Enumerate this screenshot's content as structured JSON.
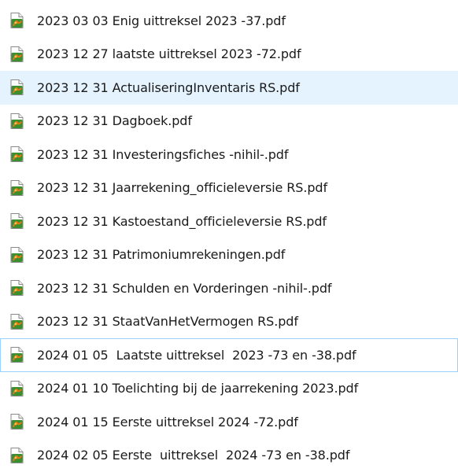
{
  "files": [
    {
      "name": "2023 03 03 Enig uittreksel 2023 -37.pdf",
      "icon": "pdf-file-icon",
      "state": "normal"
    },
    {
      "name": "2023 12 27 laatste uittreksel 2023 -72.pdf",
      "icon": "pdf-file-icon",
      "state": "normal"
    },
    {
      "name": "2023 12 31 ActualiseringInventaris RS.pdf",
      "icon": "pdf-file-icon",
      "state": "selected"
    },
    {
      "name": "2023 12 31 Dagboek.pdf",
      "icon": "pdf-file-icon",
      "state": "normal"
    },
    {
      "name": "2023 12 31 Investeringsfiches -nihil-.pdf",
      "icon": "pdf-file-icon",
      "state": "normal"
    },
    {
      "name": "2023 12 31 Jaarrekening_officieleversie RS.pdf",
      "icon": "pdf-file-icon",
      "state": "normal"
    },
    {
      "name": "2023 12 31 Kastoestand_officieleversie RS.pdf",
      "icon": "pdf-file-icon",
      "state": "normal"
    },
    {
      "name": "2023 12 31 Patrimoniumrekeningen.pdf",
      "icon": "pdf-file-icon",
      "state": "normal"
    },
    {
      "name": "2023 12 31 Schulden en Vorderingen -nihil-.pdf",
      "icon": "pdf-file-icon",
      "state": "normal"
    },
    {
      "name": "2023 12 31 StaatVanHetVermogen RS.pdf",
      "icon": "pdf-file-icon",
      "state": "normal"
    },
    {
      "name": "2024 01 05  Laatste uittreksel  2023 -73 en -38.pdf",
      "icon": "pdf-file-icon",
      "state": "focused"
    },
    {
      "name": "2024 01 10 Toelichting bij de jaarrekening 2023.pdf",
      "icon": "pdf-file-icon",
      "state": "normal"
    },
    {
      "name": "2024 01 15 Eerste uittreksel 2024 -72.pdf",
      "icon": "pdf-file-icon",
      "state": "normal"
    },
    {
      "name": "2024 02 05 Eerste  uittreksel  2024 -73 en -38.pdf",
      "icon": "pdf-file-icon",
      "state": "normal"
    }
  ],
  "colors": {
    "selected_bg": "#e5f3ff",
    "focus_border": "#99d1ff",
    "icon_green": "#3a8f2f",
    "icon_orange": "#e07b1a"
  }
}
